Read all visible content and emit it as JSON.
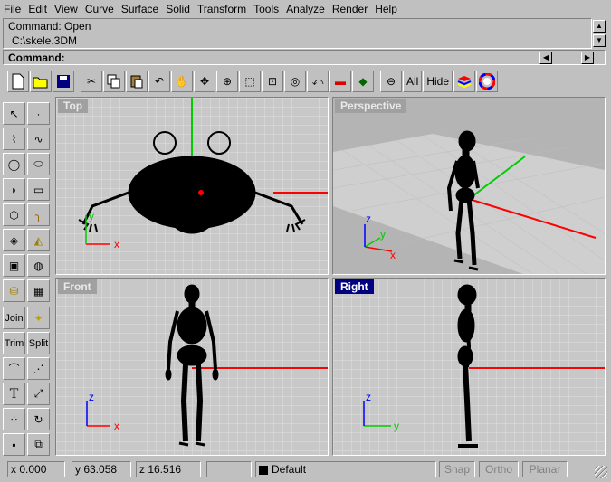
{
  "menu": [
    "File",
    "Edit",
    "View",
    "Curve",
    "Surface",
    "Solid",
    "Transform",
    "Tools",
    "Analyze",
    "Render",
    "Help"
  ],
  "command_history": [
    "Command: Open",
    "C:\\skele.3DM"
  ],
  "command_prompt": "Command:",
  "toolbar": {
    "all_label": "All",
    "hide_label": "Hide"
  },
  "left_toolbar": {
    "join_label": "Join",
    "trim_label": "Trim",
    "split_label": "Split",
    "text_tool_label": "T"
  },
  "viewports": {
    "top": "Top",
    "perspective": "Perspective",
    "front": "Front",
    "right": "Right"
  },
  "axis_labels": {
    "x": "x",
    "y": "y",
    "z": "z"
  },
  "status": {
    "x_value": "x  0.000",
    "y_value": "y  63.058",
    "z_value": "z  16.516",
    "layer": "Default",
    "snap": "Snap",
    "ortho": "Ortho",
    "planar": "Planar"
  },
  "colors": {
    "x_axis": "#ff0000",
    "y_axis": "#00cc00",
    "z_axis": "#0000ff",
    "active_title": "#000080",
    "grid_bg": "#c8c8c8"
  }
}
